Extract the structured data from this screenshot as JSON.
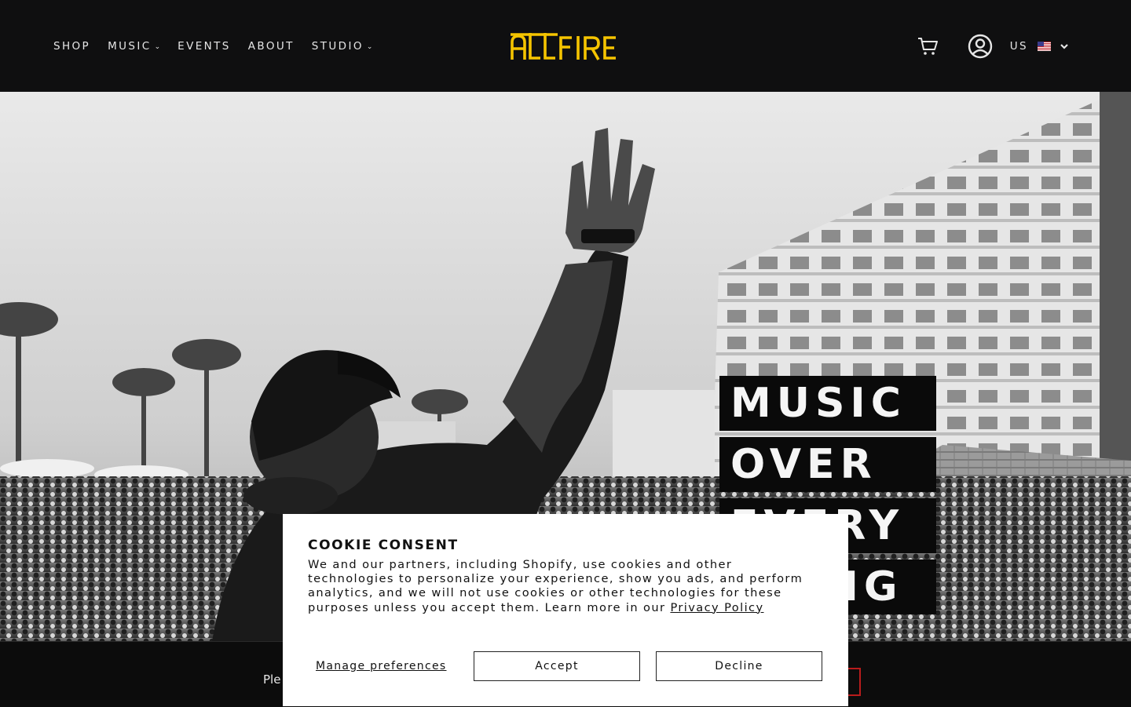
{
  "header": {
    "nav": [
      {
        "label": "SHOP",
        "has_menu": false
      },
      {
        "label": "MUSIC",
        "has_menu": true
      },
      {
        "label": "EVENTS",
        "has_menu": false
      },
      {
        "label": "ABOUT",
        "has_menu": false
      },
      {
        "label": "STUDIO",
        "has_menu": true
      }
    ],
    "chevron": "⌄",
    "logo_text": "ALLFIRE",
    "locale": "US",
    "flag_icon": "us-flag-icon",
    "brand_color": "#f5c400"
  },
  "hero": {
    "motto_lines": [
      "MUSIC",
      "OVER",
      "EVERY",
      "THING"
    ]
  },
  "bottom_bar": {
    "text": "Ple"
  },
  "cookie": {
    "title": "COOKIE CONSENT",
    "body": "We and our partners, including Shopify, use cookies and other technologies to personalize your experience, show you ads, and perform analytics, and we will not use cookies or other technologies for these purposes unless you accept them. Learn more in our ",
    "link": "Privacy Policy",
    "manage_label": "Manage preferences",
    "accept_label": "Accept",
    "decline_label": "Decline"
  }
}
